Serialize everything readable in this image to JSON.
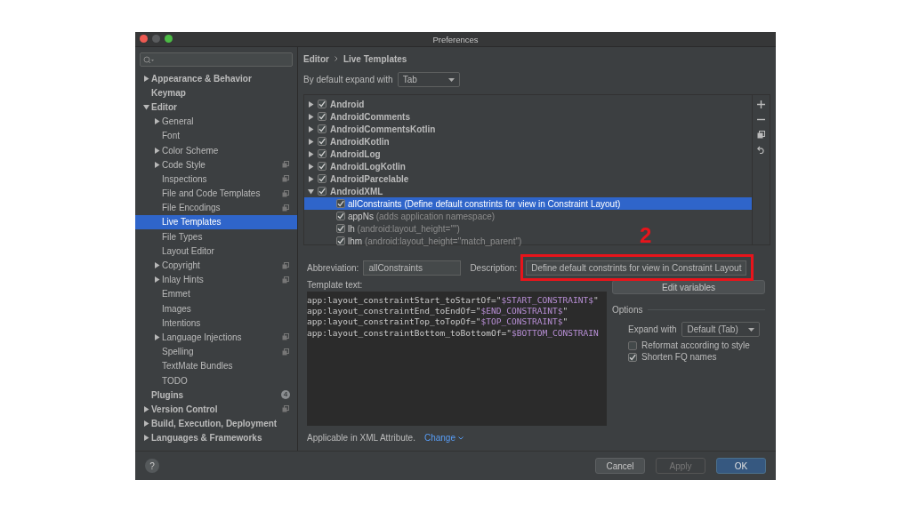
{
  "window": {
    "title": "Preferences"
  },
  "sidebar": {
    "items": [
      {
        "label": "Appearance & Behavior",
        "expanded": false,
        "scoped": false,
        "selected": false
      },
      {
        "label": "Keymap",
        "scoped": false,
        "selected": false
      },
      {
        "label": "Editor",
        "expanded": true,
        "scoped": false,
        "selected": false,
        "children": [
          {
            "label": "General",
            "expanded": false,
            "scoped": false,
            "selected": false
          },
          {
            "label": "Font",
            "scoped": false,
            "selected": false
          },
          {
            "label": "Color Scheme",
            "expanded": false,
            "scoped": false,
            "selected": false
          },
          {
            "label": "Code Style",
            "expanded": false,
            "scoped": true,
            "selected": false
          },
          {
            "label": "Inspections",
            "scoped": true,
            "selected": false
          },
          {
            "label": "File and Code Templates",
            "scoped": true,
            "selected": false
          },
          {
            "label": "File Encodings",
            "scoped": true,
            "selected": false
          },
          {
            "label": "Live Templates",
            "scoped": false,
            "selected": true
          },
          {
            "label": "File Types",
            "scoped": false,
            "selected": false
          },
          {
            "label": "Layout Editor",
            "scoped": false,
            "selected": false
          },
          {
            "label": "Copyright",
            "expanded": false,
            "scoped": true,
            "selected": false
          },
          {
            "label": "Inlay Hints",
            "expanded": false,
            "scoped": true,
            "selected": false
          },
          {
            "label": "Emmet",
            "scoped": false,
            "selected": false
          },
          {
            "label": "Images",
            "scoped": false,
            "selected": false
          },
          {
            "label": "Intentions",
            "scoped": false,
            "selected": false
          },
          {
            "label": "Language Injections",
            "expanded": false,
            "scoped": true,
            "selected": false
          },
          {
            "label": "Spelling",
            "scoped": true,
            "selected": false
          },
          {
            "label": "TextMate Bundles",
            "scoped": false,
            "selected": false
          },
          {
            "label": "TODO",
            "scoped": false,
            "selected": false
          }
        ]
      },
      {
        "label": "Plugins",
        "badge": "4",
        "scoped": false,
        "selected": false
      },
      {
        "label": "Version Control",
        "expanded": false,
        "scoped": true,
        "selected": false
      },
      {
        "label": "Build, Execution, Deployment",
        "expanded": false,
        "scoped": false,
        "selected": false
      },
      {
        "label": "Languages & Frameworks",
        "expanded": false,
        "scoped": false,
        "selected": false
      }
    ]
  },
  "breadcrumb": [
    "Editor",
    "Live Templates"
  ],
  "expand_default": {
    "label": "By default expand with",
    "value": "Tab"
  },
  "templates": [
    {
      "name": "Android",
      "checked": true,
      "expanded": false,
      "selected": false
    },
    {
      "name": "AndroidComments",
      "checked": true,
      "expanded": false,
      "selected": false
    },
    {
      "name": "AndroidCommentsKotlin",
      "checked": true,
      "expanded": false,
      "selected": false
    },
    {
      "name": "AndroidKotlin",
      "checked": true,
      "expanded": false,
      "selected": false
    },
    {
      "name": "AndroidLog",
      "checked": true,
      "expanded": false,
      "selected": false
    },
    {
      "name": "AndroidLogKotlin",
      "checked": true,
      "expanded": false,
      "selected": false
    },
    {
      "name": "AndroidParcelable",
      "checked": true,
      "expanded": false,
      "selected": false
    },
    {
      "name": "AndroidXML",
      "checked": true,
      "expanded": true,
      "selected": false,
      "children": [
        {
          "abbreviation": "allConstraints",
          "description": "(Define default constrints for view in Constraint Layout)",
          "checked": true,
          "selected": true
        },
        {
          "abbreviation": "appNs",
          "description": "(adds application namespace)",
          "checked": true,
          "selected": false
        },
        {
          "abbreviation": "lh",
          "description": "(android:layout_height=\"\")",
          "checked": true,
          "selected": false
        },
        {
          "abbreviation": "lhm",
          "description": "(android:layout_height=\"match_parent\")",
          "checked": true,
          "selected": false
        }
      ]
    }
  ],
  "abbreviation": {
    "label": "Abbreviation:",
    "value": "allConstraints"
  },
  "description": {
    "label": "Description:",
    "value": "Define default constrints for view in Constraint Layout"
  },
  "annotation": {
    "label": "2"
  },
  "template_text": {
    "label": "Template text:",
    "lines": [
      [
        {
          "text": "app:layout_constraintStart_toStartOf=\"",
          "kind": "plain"
        },
        {
          "text": "$START_CONSTRAINT$",
          "kind": "variable"
        },
        {
          "text": "\"",
          "kind": "plain"
        }
      ],
      [
        {
          "text": "app:layout_constraintEnd_toEndOf=\"",
          "kind": "plain"
        },
        {
          "text": "$END_CONSTRAINT$",
          "kind": "variable"
        },
        {
          "text": "\"",
          "kind": "plain"
        }
      ],
      [
        {
          "text": "app:layout_constraintTop_toTopOf=\"",
          "kind": "plain"
        },
        {
          "text": "$TOP_CONSTRAINT$",
          "kind": "variable"
        },
        {
          "text": "\"",
          "kind": "plain"
        }
      ],
      [
        {
          "text": "app:layout_constraintBottom_toBottomOf=\"",
          "kind": "plain"
        },
        {
          "text": "$BOTTOM_CONSTRAIN",
          "kind": "variable"
        }
      ]
    ]
  },
  "edit_variables": "Edit variables",
  "options": {
    "title": "Options",
    "expand_label": "Expand with",
    "expand_value": "Default (Tab)",
    "checkboxes": [
      {
        "label": "Reformat according to style",
        "checked": false
      },
      {
        "label": "Shorten FQ names",
        "checked": true
      }
    ]
  },
  "context": {
    "text": "Applicable in XML Attribute.",
    "link": "Change"
  },
  "help": "?",
  "buttons": [
    {
      "label": "Cancel",
      "kind": "normal",
      "disabled": false
    },
    {
      "label": "Apply",
      "kind": "normal",
      "disabled": true
    },
    {
      "label": "OK",
      "kind": "default",
      "disabled": false
    }
  ]
}
